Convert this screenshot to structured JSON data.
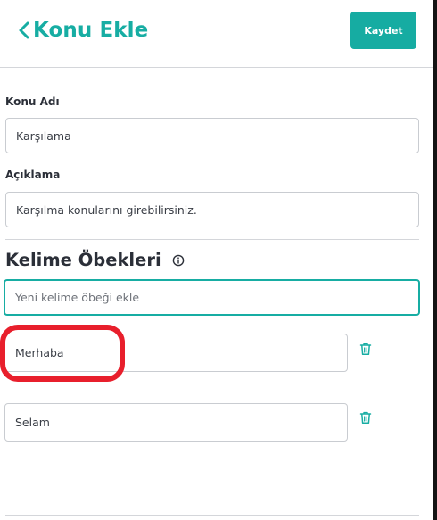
{
  "header": {
    "title": "Konu Ekle",
    "save_label": "Kaydet"
  },
  "form": {
    "topic_name": {
      "label": "Konu Adı",
      "value": "Karşılama"
    },
    "description": {
      "label": "Açıklama",
      "value": "Karşılma konularını girebilirsiniz."
    }
  },
  "phrases": {
    "title": "Kelime Öbekleri",
    "new_placeholder": "Yeni kelime öbeği ekle",
    "items": [
      {
        "value": "Merhaba"
      },
      {
        "value": "Selam"
      }
    ]
  },
  "colors": {
    "accent": "#17ada3",
    "highlight": "#e81f2c"
  }
}
